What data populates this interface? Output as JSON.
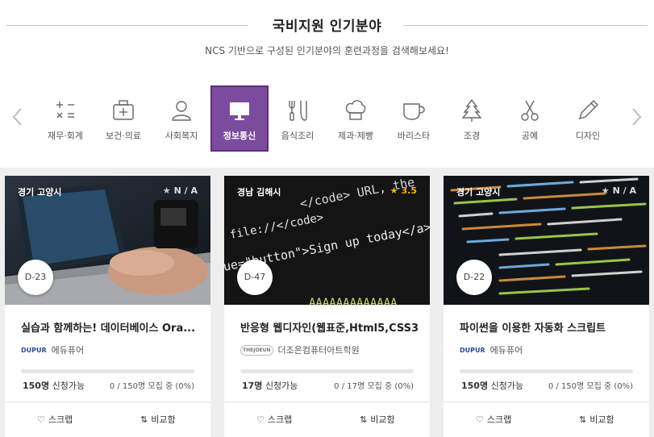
{
  "heading": {
    "title": "국비지원 인기분야",
    "subtitle": "NCS 기반으로 구성된 인기분야의 훈련과정을 검색해보세요!"
  },
  "categories": [
    {
      "label": "재무·회계",
      "icon": "calculator-icon",
      "active": false
    },
    {
      "label": "보건·의료",
      "icon": "medical-kit-icon",
      "active": false
    },
    {
      "label": "사회복지",
      "icon": "person-icon",
      "active": false
    },
    {
      "label": "정보통신",
      "icon": "monitor-icon",
      "active": true
    },
    {
      "label": "음식조리",
      "icon": "cooking-tools-icon",
      "active": false
    },
    {
      "label": "제과·제빵",
      "icon": "chef-hat-icon",
      "active": false
    },
    {
      "label": "바리스타",
      "icon": "coffee-cup-icon",
      "active": false
    },
    {
      "label": "조경",
      "icon": "tree-icon",
      "active": false
    },
    {
      "label": "공예",
      "icon": "scissors-icon",
      "active": false
    },
    {
      "label": "디자인",
      "icon": "pencil-icon",
      "active": false
    }
  ],
  "accent_color": "#7b4b9e",
  "cards": [
    {
      "location": "경기 고양시",
      "rating": "N / A",
      "rated": false,
      "dday": "D-23",
      "title": "실습과 함께하는! 데이터베이스 Ora...",
      "institution_logo": "DUPUR",
      "institution": "에듀퓨어",
      "capacity_num": "150명",
      "capacity_text": "신청가능",
      "status": "0 / 150명 모집 중 (0%)",
      "progress": 0,
      "scrap_label": "스크랩",
      "compare_label": "비교함"
    },
    {
      "location": "경남 김해시",
      "rating": "3.5",
      "rated": true,
      "dday": "D-47",
      "title": "반응형 웹디자인(웹표준,Html5,CSS3...",
      "institution_logo": "THEJOEUN",
      "institution": "더조은컴퓨터아트학원",
      "capacity_num": "17명",
      "capacity_text": "신청가능",
      "status": "0 / 17명 모집 중 (0%)",
      "progress": 0,
      "scrap_label": "스크랩",
      "compare_label": "비교함"
    },
    {
      "location": "경기 고양시",
      "rating": "N / A",
      "rated": false,
      "dday": "D-22",
      "title": "파이썬을 이용한 자동화 스크립트",
      "institution_logo": "DUPUR",
      "institution": "에듀퓨어",
      "capacity_num": "150명",
      "capacity_text": "신청가능",
      "status": "0 / 150명 모집 중 (0%)",
      "progress": 0,
      "scrap_label": "스크랩",
      "compare_label": "비교함"
    }
  ],
  "code_image_text": {
    "line1": "</code> URL, the",
    "line2": "file://</code>",
    "line3": "ue=\"button\">Sign up today</a>",
    "line4": "AAAAAAAAAAAAA"
  }
}
